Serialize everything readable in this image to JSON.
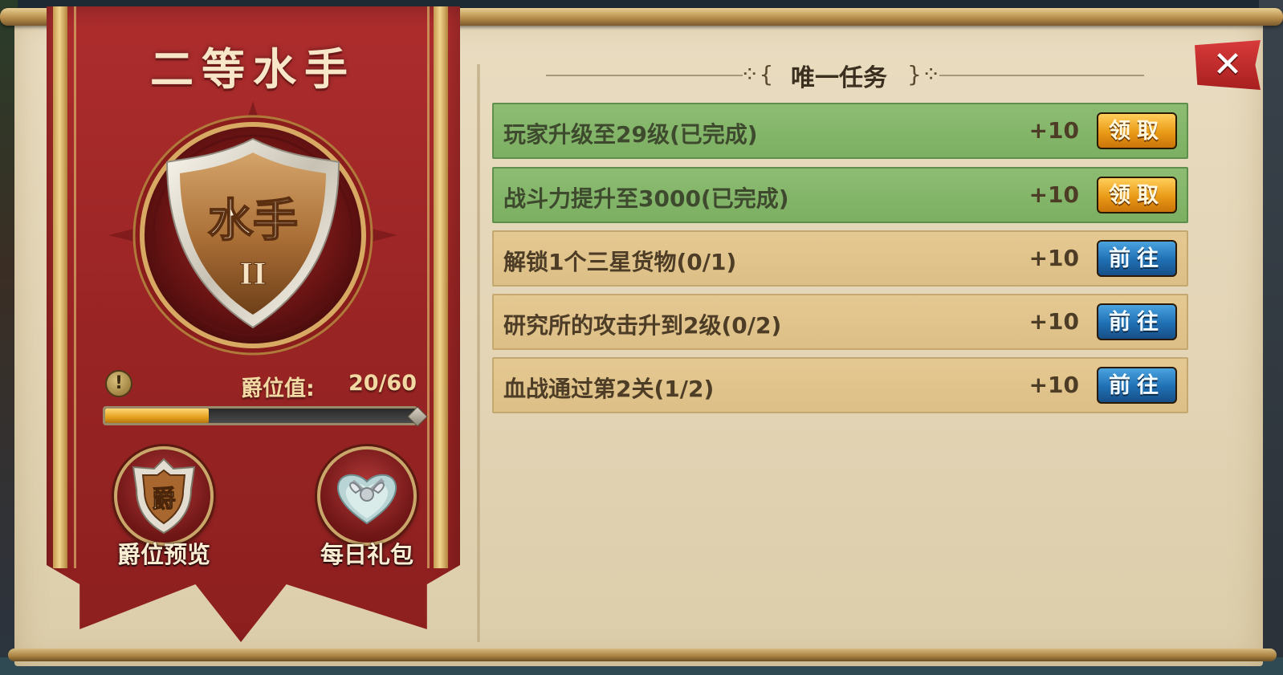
{
  "rank": {
    "title": "二等水手",
    "emblem_text": "水手",
    "emblem_numeral": "II",
    "value_label": "爵位值:",
    "value_text": "20/60",
    "progress": 0.333
  },
  "buttons": {
    "preview_label": "爵位预览",
    "preview_badge": "爵",
    "gift_label": "每日礼包",
    "close_symbol": "✕"
  },
  "tasks": {
    "title": "唯一任务",
    "orn_left": "⁘{",
    "orn_right": "}⁘",
    "items": [
      {
        "text": "玩家升级至29级(已完成)",
        "reward": "+10",
        "button": "领取",
        "state": "done"
      },
      {
        "text": "战斗力提升至3000(已完成)",
        "reward": "+10",
        "button": "领取",
        "state": "done"
      },
      {
        "text": "解锁1个三星货物(0/1)",
        "reward": "+10",
        "button": "前往",
        "state": "todo"
      },
      {
        "text": "研究所的攻击升到2级(0/2)",
        "reward": "+10",
        "button": "前往",
        "state": "todo"
      },
      {
        "text": "血战通过第2关(1/2)",
        "reward": "+10",
        "button": "前往",
        "state": "todo"
      }
    ]
  },
  "colors": {
    "banner": "#992424",
    "done_row": "#8cbd72",
    "todo_row": "#e5c992",
    "claim_button": "#e99a16",
    "go_button": "#1f6fb3",
    "progress_fill": "#e6a21e"
  },
  "icons": [
    "info-icon",
    "rank-shield-icon",
    "rank-badge-icon",
    "gift-box-icon",
    "close-icon"
  ]
}
